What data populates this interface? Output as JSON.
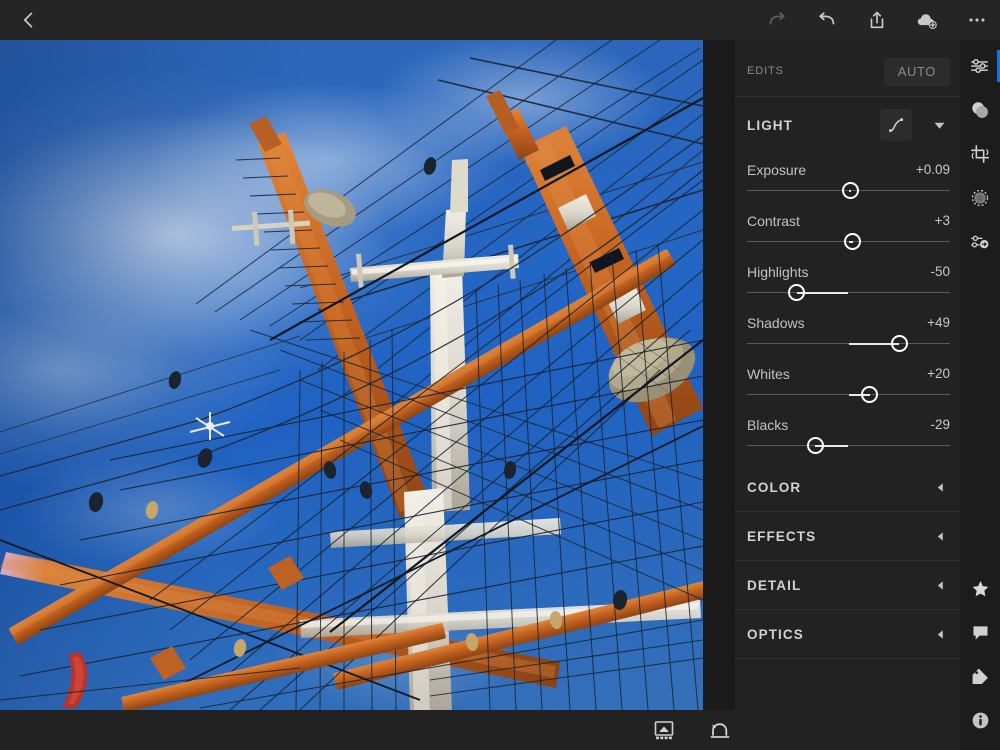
{
  "topbar": {
    "back_icon": "chevron-left-icon",
    "actions": [
      {
        "name": "redo-button",
        "icon": "redo-icon",
        "enabled": false
      },
      {
        "name": "undo-button",
        "icon": "undo-icon",
        "enabled": true
      },
      {
        "name": "share-button",
        "icon": "share-icon",
        "enabled": true
      },
      {
        "name": "add-to-cloud-button",
        "icon": "cloud-add-icon",
        "enabled": true
      },
      {
        "name": "more-options-button",
        "icon": "ellipsis-icon",
        "enabled": true
      }
    ]
  },
  "panel": {
    "edits_label": "EDITS",
    "auto_label": "AUTO",
    "light": {
      "title": "LIGHT",
      "curve_icon": "tone-curve-icon",
      "chevron_icon": "chevron-down-icon",
      "sliders": [
        {
          "name": "Exposure",
          "value": "+0.09",
          "pos": 51.0,
          "center": 50
        },
        {
          "name": "Contrast",
          "value": "+3",
          "pos": 52.0,
          "center": 50
        },
        {
          "name": "Highlights",
          "value": "-50",
          "pos": 24.5,
          "center": 50
        },
        {
          "name": "Shadows",
          "value": "+49",
          "pos": 75.0,
          "center": 50
        },
        {
          "name": "Whites",
          "value": "+20",
          "pos": 60.5,
          "center": 50
        },
        {
          "name": "Blacks",
          "value": "-29",
          "pos": 33.5,
          "center": 50
        }
      ]
    },
    "collapsed_sections": [
      {
        "title": "COLOR",
        "chevron_icon": "chevron-left-icon"
      },
      {
        "title": "EFFECTS",
        "chevron_icon": "chevron-left-icon"
      },
      {
        "title": "DETAIL",
        "chevron_icon": "chevron-left-icon"
      },
      {
        "title": "OPTICS",
        "chevron_icon": "chevron-left-icon"
      }
    ]
  },
  "rail": {
    "accent_color": "#1473e6",
    "top_items": [
      {
        "name": "rail-edit-sliders",
        "icon": "sliders-icon",
        "active": true
      },
      {
        "name": "rail-color-mix",
        "icon": "color-circle-icon",
        "active": false
      },
      {
        "name": "rail-crop",
        "icon": "crop-rotate-icon",
        "active": false
      },
      {
        "name": "rail-healing",
        "icon": "healing-circle-icon",
        "active": false
      },
      {
        "name": "rail-presets",
        "icon": "preset-sliders-icon",
        "active": false
      }
    ],
    "bottom_items": [
      {
        "name": "rail-rating",
        "icon": "star-icon"
      },
      {
        "name": "rail-comments",
        "icon": "comment-icon"
      },
      {
        "name": "rail-keywords",
        "icon": "tag-icon"
      },
      {
        "name": "rail-info",
        "icon": "info-icon"
      }
    ]
  },
  "bottombar": {
    "items": [
      {
        "name": "before-after-button",
        "icon": "before-after-icon"
      },
      {
        "name": "reset-button",
        "icon": "reset-icon"
      }
    ]
  },
  "photo": {
    "subject": "tall-ship-masts-and-rigging",
    "sky_color": "#2466c4",
    "spar_color": "#c96a27",
    "mast_color": "#e3e0d8",
    "flag_color": "#c0372b"
  }
}
